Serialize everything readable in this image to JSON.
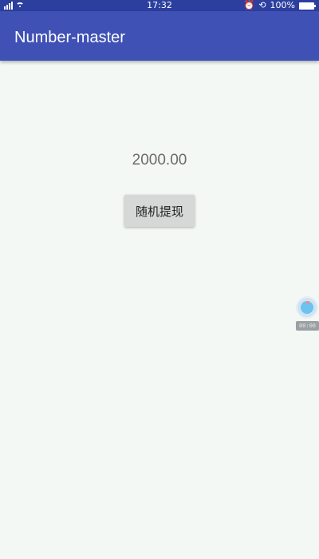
{
  "status_bar": {
    "time": "17:32",
    "battery": "100%",
    "icons": [
      "signal-icon",
      "wifi-icon",
      "alarm-icon",
      "rotation-lock-icon",
      "battery-icon"
    ]
  },
  "toolbar": {
    "title": "Number-master",
    "color": "#3f51b5"
  },
  "main": {
    "amount": "2000.00",
    "withdraw_button_label": "随机提现"
  },
  "float_widget": {
    "timer": "00:00"
  }
}
